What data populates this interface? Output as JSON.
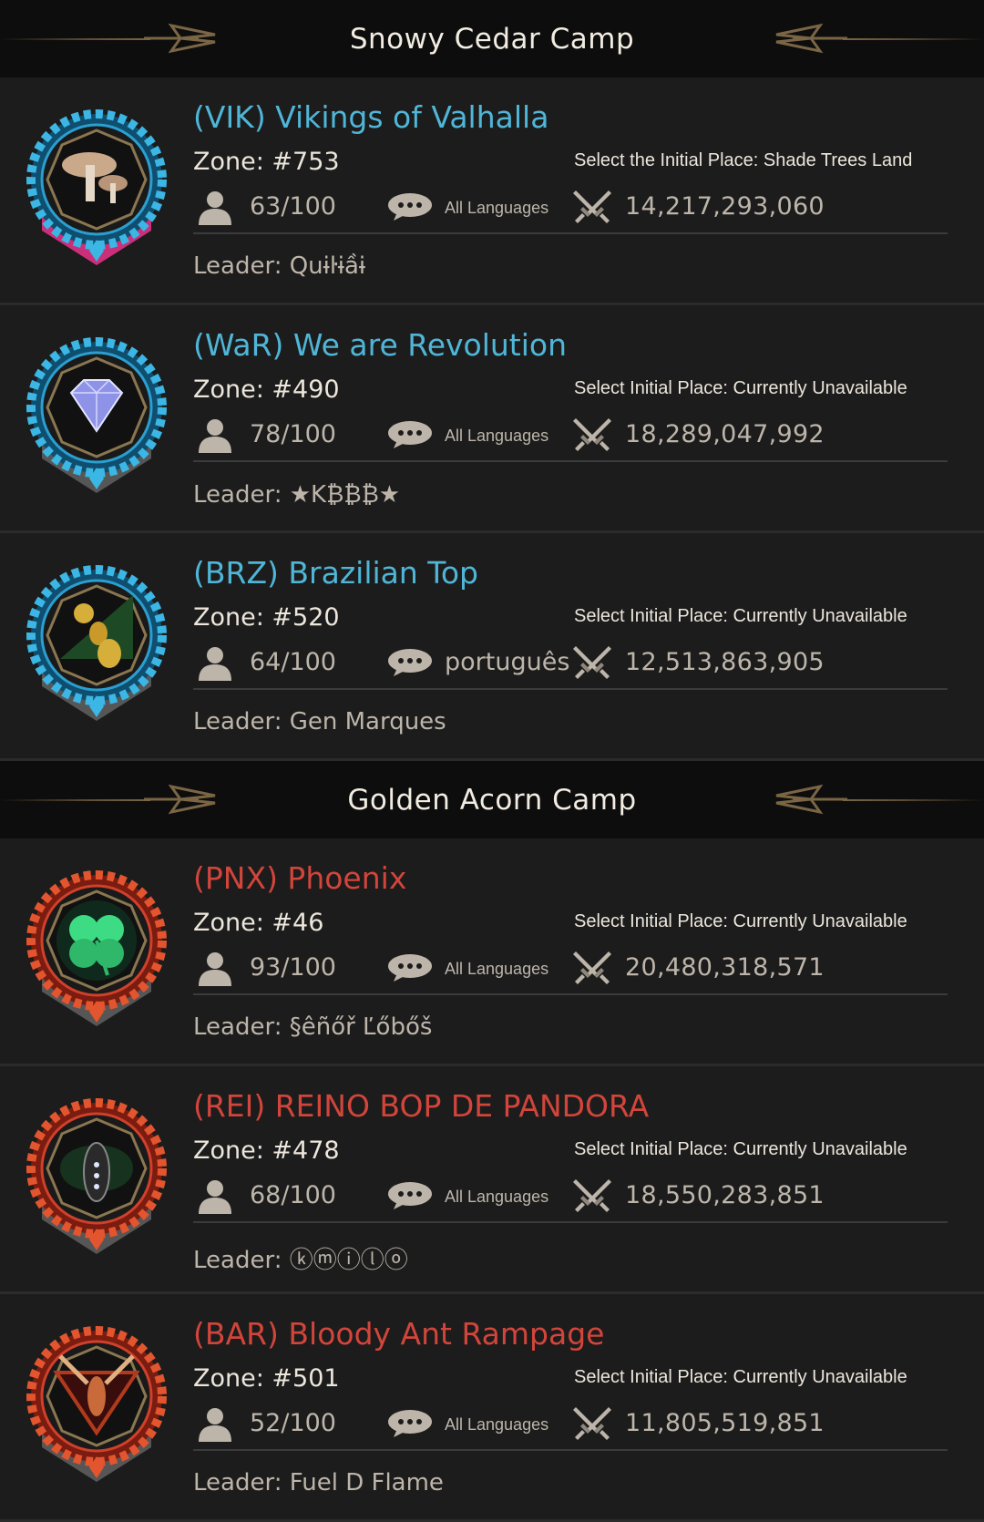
{
  "camps": [
    {
      "title": "Snowy Cedar Camp",
      "guilds": [
        {
          "name": "(VIK) Vikings of Valhalla",
          "name_color": "blue",
          "zone": "Zone: #753",
          "initial_place": "Select the Initial Place: Shade Trees Land",
          "members": "63/100",
          "language": "All Languages",
          "power": "14,217,293,060",
          "leader": "Leader: Quɨŀɨầɨ",
          "crest": {
            "theme": "blue",
            "ribbon": "#d6307e",
            "emblem": "mushroom"
          }
        },
        {
          "name": "(WaR) We are Revolution",
          "name_color": "blue",
          "zone": "Zone: #490",
          "initial_place": "Select Initial Place: Currently Unavailable",
          "members": "78/100",
          "language": "All Languages",
          "power": "18,289,047,992",
          "leader": "Leader: ★K₿₿₿★",
          "crest": {
            "theme": "blue",
            "ribbon": "#5a5a5a",
            "emblem": "diamond"
          }
        },
        {
          "name": "(BRZ) Brazilian Top",
          "name_color": "blue",
          "zone": "Zone: #520",
          "initial_place": "Select Initial Place: Currently Unavailable",
          "members": "64/100",
          "language": "português",
          "language_large": true,
          "power": "12,513,863,905",
          "leader": "Leader: Gen Marques",
          "crest": {
            "theme": "blue",
            "ribbon": "#5a5a5a",
            "emblem": "ant"
          }
        }
      ]
    },
    {
      "title": "Golden Acorn Camp",
      "guilds": [
        {
          "name": "(PNX) Phoenix",
          "name_color": "red",
          "zone": "Zone: #46",
          "initial_place": "Select Initial Place: Currently Unavailable",
          "members": "93/100",
          "language": "All Languages",
          "power": "20,480,318,571",
          "leader": "Leader: §êñőř Ľőbőš",
          "crest": {
            "theme": "red",
            "ribbon": "#5a5a5a",
            "emblem": "clover"
          }
        },
        {
          "name": "(REI) REINO BOP DE PANDORA",
          "name_color": "red",
          "zone": "Zone: #478",
          "initial_place": "Select Initial Place: Currently Unavailable",
          "members": "68/100",
          "language": "All Languages",
          "power": "18,550,283,851",
          "leader": "Leader: ⓚⓜⓘⓛⓞ",
          "crest": {
            "theme": "red",
            "ribbon": "#5a5a5a",
            "emblem": "beetle"
          }
        },
        {
          "name": "(BAR) Bloody Ant Rampage",
          "name_color": "red",
          "zone": "Zone: #501",
          "initial_place": "Select Initial Place: Currently Unavailable",
          "members": "52/100",
          "language": "All Languages",
          "power": "11,805,519,851",
          "leader": "Leader: Fuel D Flame",
          "crest": {
            "theme": "red",
            "ribbon": "#5a5a5a",
            "emblem": "wasp"
          }
        }
      ]
    }
  ],
  "colors": {
    "blue_name": "#4fb6d8",
    "red_name": "#d1453b",
    "background": "#1c1c1c",
    "header_background": "#0d0d0d"
  },
  "icons": [
    "member-icon",
    "chat-icon",
    "crossed-swords-icon",
    "wing-ornament-icon"
  ]
}
